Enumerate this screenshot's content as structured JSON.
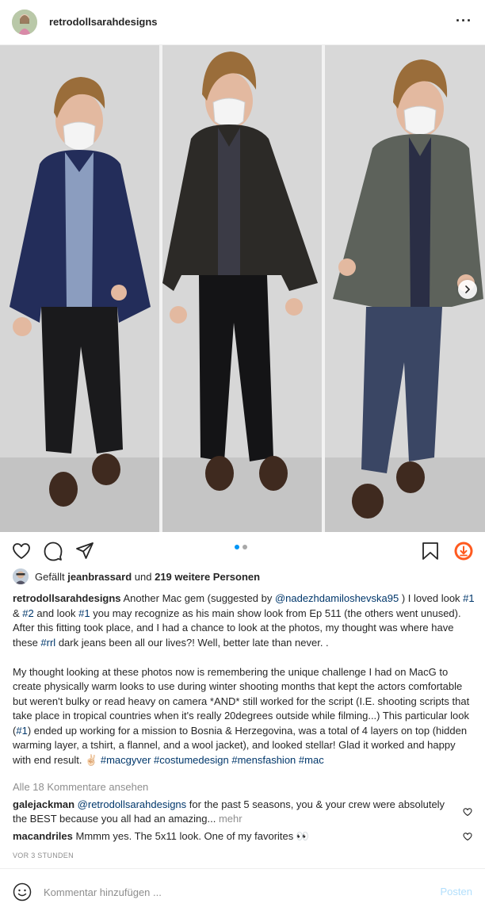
{
  "header": {
    "username": "retrodollsarahdesigns",
    "more_icon": "more-horizontal-icon"
  },
  "carousel": {
    "slide_count": 2,
    "active_index": 0,
    "next_icon": "chevron-right-icon"
  },
  "actions": {
    "like_icon": "heart-icon",
    "comment_icon": "comment-icon",
    "share_icon": "share-icon",
    "save_icon": "bookmark-icon",
    "download_icon": "download-icon"
  },
  "likes": {
    "prefix": "Gefällt",
    "user": "jeanbrassard",
    "middle": "und",
    "others": "219 weitere Personen"
  },
  "caption": {
    "username": "retrodollsarahdesigns",
    "p1_a": " Another Mac gem (suggested by ",
    "p1_mention": "@nadezhdamiloshevska95",
    "p1_b": " ) I loved look ",
    "p1_tag1": "#1",
    "p1_c": " & ",
    "p1_tag2": "#2",
    "p1_d": " and look ",
    "p1_tag3": "#1",
    "p1_e": " you may recognize as his main show look from Ep 511 (the others went unused). After this fitting took place, and I had a chance to look at the photos, my thought was where have these ",
    "p1_tag4": "#rrl",
    "p1_f": " dark jeans been all our lives?! Well, better late than never. .",
    "p2_a": "My thought looking at these photos now is remembering the unique challenge I had on MacG to create physically warm looks to use during winter shooting months that kept the actors comfortable but weren't bulky or read heavy on camera *AND* still worked for the script (I.E. shooting scripts that take place in tropical countries when it's really 20degrees outside while filming...) This particular look (",
    "p2_tag1": "#1",
    "p2_b": ") ended up working for a mission to Bosnia & Herzegovina, was a total of 4 layers on top (hidden warming layer, a tshirt, a flannel, and a wool jacket), and looked stellar! Glad it worked and happy with end result. ✌🏻 ",
    "p2_tag2": "#macgyver",
    "p2_c": " ",
    "p2_tag3": "#costumedesign",
    "p2_d": " ",
    "p2_tag4": "#mensfashion",
    "p2_e": " ",
    "p2_tag5": "#mac"
  },
  "comments": {
    "view_all": "Alle 18 Kommentare ansehen",
    "items": [
      {
        "user": "galejackman",
        "mention": "@retrodollsarahdesigns",
        "text": " for the past 5 seasons, you & your crew were absolutely the BEST because you all had an amazing...",
        "more": "mehr"
      },
      {
        "user": "macandriles",
        "text": " Mmmm yes. The 5x11 look. One of my favorites 👀"
      }
    ],
    "timestamp": "VOR 3 STUNDEN"
  },
  "add_comment": {
    "placeholder": "Kommentar hinzufügen ...",
    "post_label": "Posten",
    "emoji_icon": "smiley-icon"
  },
  "colors": {
    "link": "#00376b",
    "active_dot": "#0095f6",
    "post_disabled": "#b2dffc",
    "download_accent": "#ff5a1f"
  }
}
